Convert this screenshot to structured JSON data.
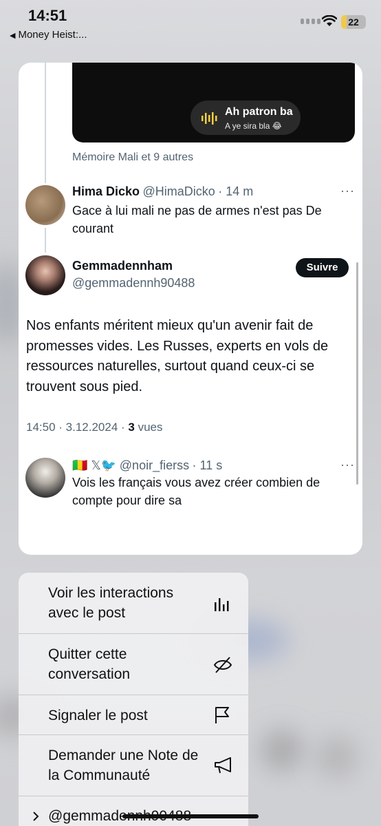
{
  "status_bar": {
    "time": "14:51",
    "back_app": "Money Heist:...",
    "battery_level": "22"
  },
  "media": {
    "audio_title": "Ah patron ba",
    "audio_subtitle": "A ye sira bla 😂"
  },
  "liked_by": "Mémoire Mali et 9 autres",
  "reply1": {
    "name": "Hima Dicko",
    "handle": "@HimaDicko",
    "time": "· 14 m",
    "line1": "Gace à lui mali ne pas de armes n'est pas De",
    "line2": "courant"
  },
  "main_post": {
    "name": "Gemmadennham",
    "handle": "@gemmadennh90488",
    "follow_label": "Suivre",
    "text": "Nos enfants méritent mieux qu'un avenir fait de promesses vides. Les Russes, experts en vols de ressources naturelles, surtout quand ceux-ci se trouvent sous pied.",
    "timestamp": "14:50 · 3.12.2024 · ",
    "views_count": "3",
    "views_label": " vues"
  },
  "reply2": {
    "flags": "🇲🇱 𝕏🐦",
    "handle": "@noir_fierss",
    "time": "· 11 s",
    "line1": "Vois les français vous avez créer combien de",
    "line2": "compte pour dire sa"
  },
  "menu": {
    "item1": "Voir les interactions avec le post",
    "item2": "Quitter cette conversation",
    "item3": "Signaler le post",
    "item4": "Demander une Note de la Communauté",
    "item5": "@gemmadennh90488"
  }
}
